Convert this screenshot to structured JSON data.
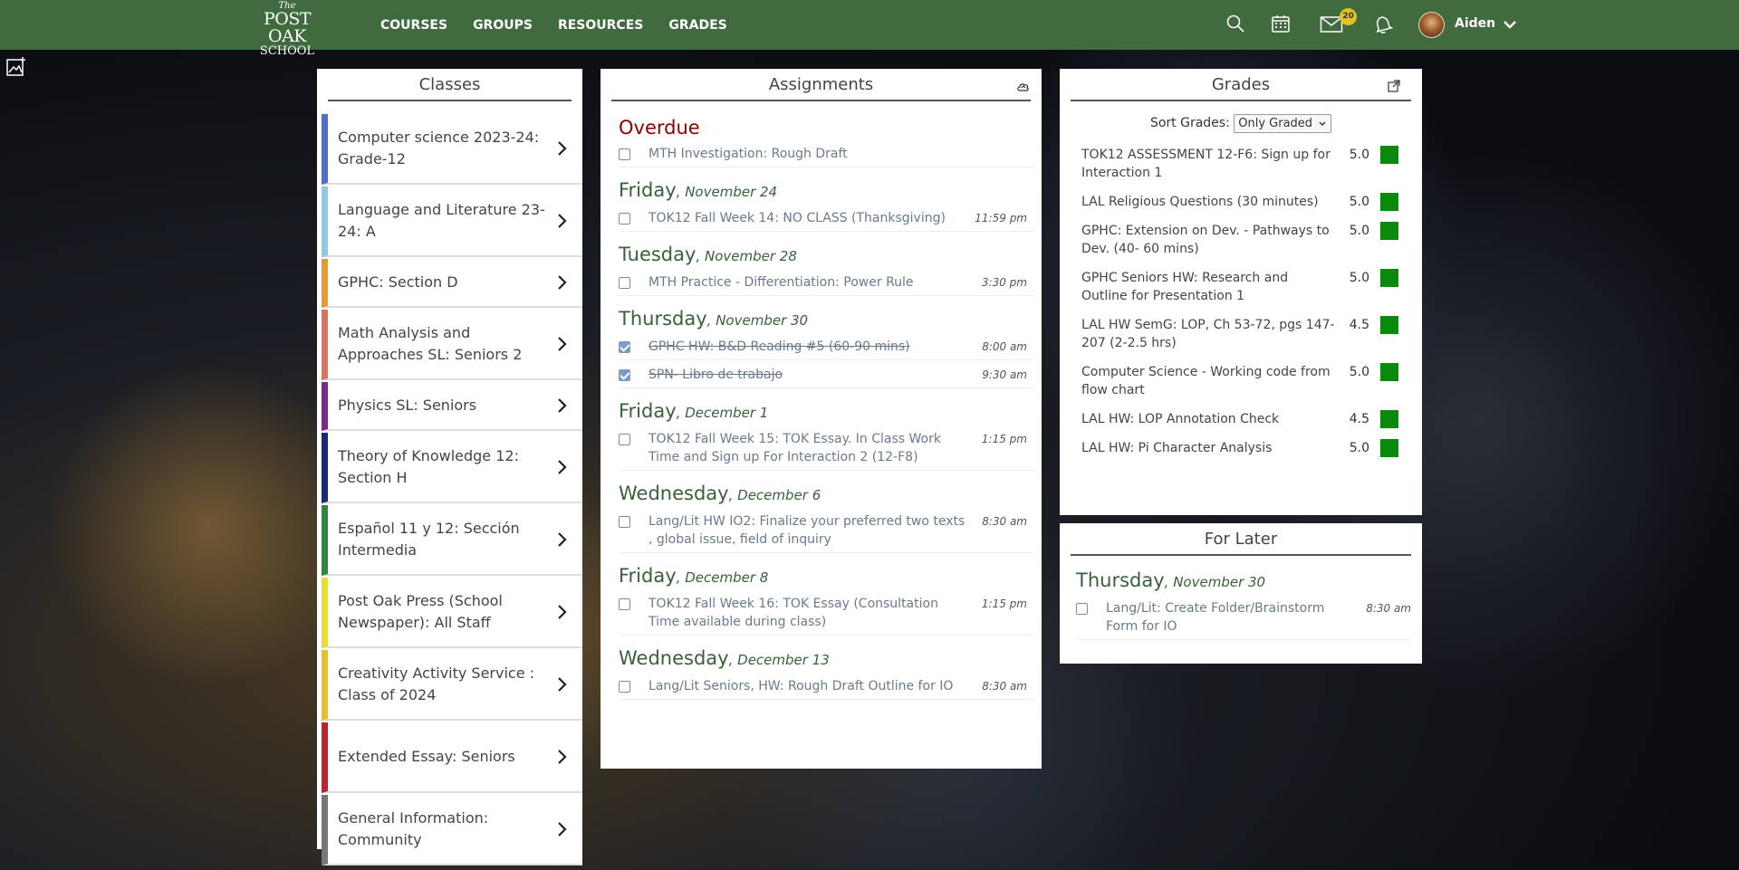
{
  "nav": {
    "logo": {
      "top": "The",
      "middle": "POST OAK",
      "bottom": "SCHOOL"
    },
    "links": [
      "COURSES",
      "GROUPS",
      "RESOURCES",
      "GRADES"
    ],
    "mail_badge": "20",
    "username": "Aiden"
  },
  "classes": {
    "title": "Classes",
    "items": [
      {
        "label": "Computer science 2023-24: Grade-12",
        "color": "#4a6fd0"
      },
      {
        "label": "Language and Literature 23-24: A",
        "color": "#8ec8e8"
      },
      {
        "label": "GPHC: Section D",
        "color": "#e89a2a"
      },
      {
        "label": "Math Analysis and Approaches SL: Seniors 2",
        "color": "#e07060"
      },
      {
        "label": "Physics SL: Seniors",
        "color": "#7a2a8a"
      },
      {
        "label": "Theory of Knowledge 12: Section H",
        "color": "#1a2a7a"
      },
      {
        "label": "Español 11 y 12: Sección Intermedia",
        "color": "#2a8a3a"
      },
      {
        "label": "Post Oak Press (School Newspaper): All Staff",
        "color": "#e8e020"
      },
      {
        "label": "Creativity Activity Service : Class of 2024",
        "color": "#e8c020"
      },
      {
        "label": "Extended Essay: Seniors",
        "color": "#c02030"
      },
      {
        "label": "General Information: Community",
        "color": "#777777"
      }
    ]
  },
  "assignments": {
    "title": "Assignments",
    "overdue_label": "Overdue",
    "overdue": [
      {
        "text": "MTH Investigation: Rough Draft",
        "time": "",
        "done": false
      }
    ],
    "days": [
      {
        "day": "Friday",
        "date": "November 24",
        "items": [
          {
            "text": "TOK12 Fall Week 14: NO CLASS (Thanksgiving)",
            "time": "11:59 pm",
            "done": false
          }
        ]
      },
      {
        "day": "Tuesday",
        "date": "November 28",
        "items": [
          {
            "text": "MTH Practice - Differentiation: Power Rule",
            "time": "3:30 pm",
            "done": false
          }
        ]
      },
      {
        "day": "Thursday",
        "date": "November 30",
        "items": [
          {
            "text": "GPHC HW: B&D Reading #5 (60-90 mins)",
            "time": "8:00 am",
            "done": true
          },
          {
            "text": "SPN- Libro de trabajo",
            "time": "9:30 am",
            "done": true
          }
        ]
      },
      {
        "day": "Friday",
        "date": "December 1",
        "items": [
          {
            "text": "TOK12 Fall Week 15: TOK Essay. In Class Work Time and Sign up For Interaction 2 (12-F8)",
            "time": "1:15 pm",
            "done": false
          }
        ]
      },
      {
        "day": "Wednesday",
        "date": "December 6",
        "items": [
          {
            "text": "Lang/Lit HW IO2: Finalize your preferred two texts , global issue, field of inquiry",
            "time": "8:30 am",
            "done": false
          }
        ]
      },
      {
        "day": "Friday",
        "date": "December 8",
        "items": [
          {
            "text": "TOK12 Fall Week 16: TOK Essay (Consultation Time available during class)",
            "time": "1:15 pm",
            "done": false
          }
        ]
      },
      {
        "day": "Wednesday",
        "date": "December 13",
        "items": [
          {
            "text": "Lang/Lit Seniors, HW: Rough Draft Outline for IO",
            "time": "8:30 am",
            "done": false
          }
        ]
      }
    ]
  },
  "grades": {
    "title": "Grades",
    "sort_label": "Sort Grades:",
    "sort_value": "Only Graded",
    "items": [
      {
        "text": "TOK12 ASSESSMENT 12-F6: Sign up for Interaction 1",
        "value": "5.0"
      },
      {
        "text": "LAL Religious Questions (30 minutes)",
        "value": "5.0"
      },
      {
        "text": "GPHC: Extension on Dev. - Pathways to Dev. (40- 60 mins)",
        "value": "5.0"
      },
      {
        "text": "GPHC Seniors HW: Research and Outline for Presentation 1",
        "value": "5.0"
      },
      {
        "text": "LAL HW SemG: LOP, Ch 53-72, pgs 147-207 (2-2.5 hrs)",
        "value": "4.5"
      },
      {
        "text": "Computer Science - Working code from flow chart",
        "value": "5.0"
      },
      {
        "text": "LAL HW: LOP Annotation Check",
        "value": "4.5"
      },
      {
        "text": "LAL HW: Pi Character Analysis",
        "value": "5.0"
      }
    ]
  },
  "for_later": {
    "title": "For Later",
    "day": "Thursday",
    "date": "November 30",
    "items": [
      {
        "text": "Lang/Lit: Create Folder/Brainstorm Form for IO",
        "time": "8:30 am"
      }
    ]
  },
  "colors": {
    "nav": "#3f6b3f",
    "heading_green": "#3a5f3a",
    "overdue_red": "#8b0000",
    "grade_bar": "#0a8a0a"
  }
}
